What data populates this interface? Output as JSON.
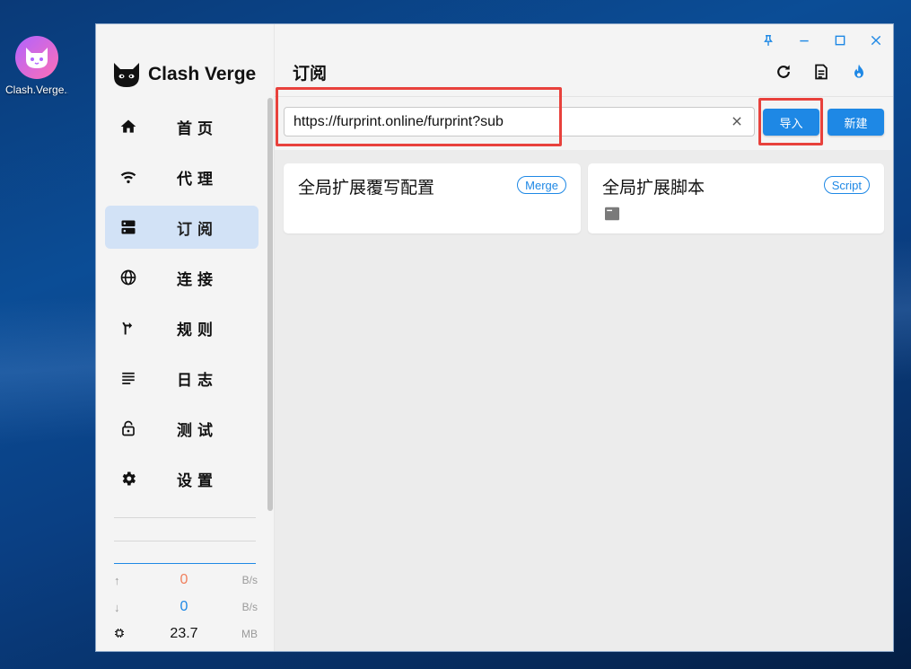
{
  "desktop": {
    "icon_label": "Clash.Verge..."
  },
  "app": {
    "brand": "Clash Verge",
    "page_title": "订阅"
  },
  "nav": {
    "items": [
      {
        "label": "首页",
        "icon": "home-icon"
      },
      {
        "label": "代理",
        "icon": "wifi-icon"
      },
      {
        "label": "订阅",
        "icon": "dns-icon",
        "active": true
      },
      {
        "label": "连接",
        "icon": "globe-icon"
      },
      {
        "label": "规则",
        "icon": "fork-arrow-icon"
      },
      {
        "label": "日志",
        "icon": "lines-icon"
      },
      {
        "label": "测试",
        "icon": "unlock-icon"
      },
      {
        "label": "设置",
        "icon": "gear-icon"
      }
    ]
  },
  "traffic": {
    "up_value": "0",
    "up_unit": "B/s",
    "down_value": "0",
    "down_unit": "B/s",
    "memory_value": "23.7",
    "memory_unit": "MB"
  },
  "toolbar": {
    "url_value": "https://furprint.online/furprint?sub",
    "import_label": "导入",
    "new_label": "新建"
  },
  "cards": [
    {
      "title": "全局扩展覆写配置",
      "badge": "Merge"
    },
    {
      "title": "全局扩展脚本",
      "badge": "Script"
    }
  ],
  "colors": {
    "accent": "#1e88e5",
    "upload": "#f07f5c",
    "download": "#1e88e5",
    "highlight": "#e8413c",
    "active_nav": "#d2e2f6"
  }
}
